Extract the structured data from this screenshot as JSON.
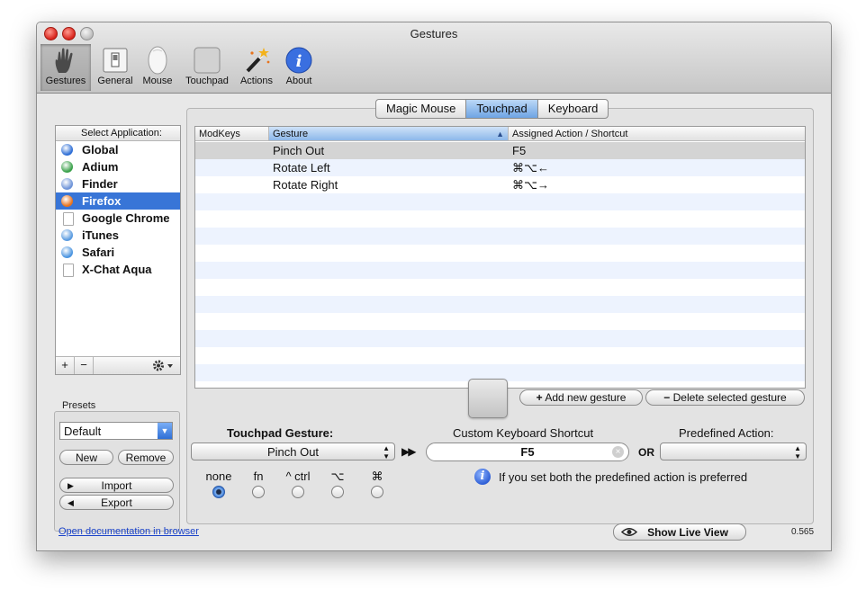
{
  "window": {
    "title": "Gestures"
  },
  "toolbar": {
    "items": [
      {
        "label": "Gestures",
        "icon": "hand-icon",
        "selected": true
      },
      {
        "label": "General",
        "icon": "switch-icon",
        "selected": false
      },
      {
        "label": "Mouse",
        "icon": "magic-mouse-icon",
        "selected": false
      },
      {
        "label": "Touchpad",
        "icon": "touchpad-icon",
        "selected": false
      },
      {
        "label": "Actions",
        "icon": "magic-wand-icon",
        "selected": false
      },
      {
        "label": "About",
        "icon": "info-icon",
        "selected": false
      }
    ]
  },
  "sidebar": {
    "header": "Select Application:",
    "apps": [
      {
        "name": "Global",
        "icon": "globe-icon",
        "color": "#2f6fd6",
        "selected": false
      },
      {
        "name": "Adium",
        "icon": "adium-duck-icon",
        "color": "#3aa14a",
        "selected": false
      },
      {
        "name": "Finder",
        "icon": "finder-icon",
        "color": "#6d93d8",
        "selected": false
      },
      {
        "name": "Firefox",
        "icon": "firefox-icon",
        "color": "#e8731d",
        "selected": true
      },
      {
        "name": "Google Chrome",
        "icon": "document-icon",
        "color": "#ffffff",
        "selected": false
      },
      {
        "name": "iTunes",
        "icon": "itunes-icon",
        "color": "#5a9be0",
        "selected": false
      },
      {
        "name": "Safari",
        "icon": "safari-compass-icon",
        "color": "#4c95e0",
        "selected": false
      },
      {
        "name": "X-Chat Aqua",
        "icon": "document-icon",
        "color": "#ffffff",
        "selected": false
      }
    ],
    "add_label": "+",
    "remove_label": "−",
    "gear_icon": "gear-icon"
  },
  "presets": {
    "label": "Presets",
    "selected": "Default",
    "new_label": "New",
    "remove_label": "Remove",
    "import_label": "Import",
    "export_label": "Export"
  },
  "device_tabs": [
    {
      "label": "Magic Mouse",
      "active": false
    },
    {
      "label": "Touchpad",
      "active": true
    },
    {
      "label": "Keyboard",
      "active": false
    }
  ],
  "table": {
    "columns": [
      "ModKeys",
      "Gesture",
      "Assigned Action / Shortcut"
    ],
    "rows": [
      {
        "modkeys": "",
        "gesture": "Pinch Out",
        "action": "F5"
      },
      {
        "modkeys": "",
        "gesture": "Rotate Left",
        "action": "⌘⌥←"
      },
      {
        "modkeys": "",
        "gesture": "Rotate Right",
        "action": "⌘⌥→"
      }
    ],
    "empty_rows": 12
  },
  "actions": {
    "add_gesture": "Add new gesture",
    "delete_gesture": "Delete selected gesture"
  },
  "editor": {
    "touchpad_gesture_label": "Touchpad Gesture:",
    "gesture_value": "Pinch Out",
    "custom_shortcut_label": "Custom Keyboard Shortcut",
    "shortcut_value": "F5",
    "or_label": "OR",
    "predefined_label": "Predefined Action:",
    "predefined_value": "",
    "modifiers": [
      {
        "label": "none",
        "checked": true
      },
      {
        "label": "fn",
        "checked": false
      },
      {
        "label": "^ ctrl",
        "checked": false
      },
      {
        "label": "⌥",
        "checked": false
      },
      {
        "label": "⌘",
        "checked": false
      }
    ],
    "info_text": "If you set both the predefined action is preferred"
  },
  "footer": {
    "doc_link": "Open documentation in browser",
    "live_view": "Show Live View",
    "version": "0.565"
  }
}
